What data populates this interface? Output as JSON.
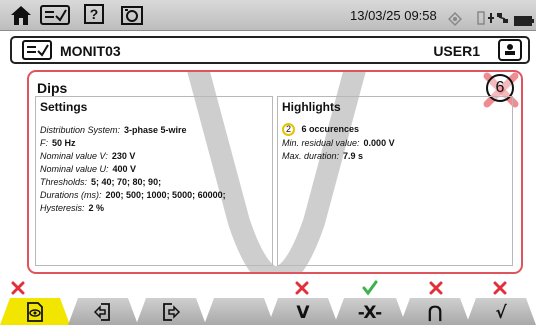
{
  "status_bar": {
    "datetime": "13/03/25 09:58",
    "help_label": "?",
    "network_label": "☉♁♂"
  },
  "header": {
    "title": "MONIT03",
    "user": "USER1"
  },
  "panel": {
    "title": "Dips",
    "count": "6",
    "settings": {
      "title": "Settings",
      "rows": [
        {
          "label": "Distribution System:",
          "value": "3-phase 5-wire"
        },
        {
          "label": "F:",
          "value": "50 Hz"
        },
        {
          "label": "Nominal value V:",
          "value": "230 V"
        },
        {
          "label": "Nominal value U:",
          "value": "400 V"
        },
        {
          "label": "Thresholds:",
          "value": "5; 40; 70; 80; 90;"
        },
        {
          "label": "Durations (ms):",
          "value": "200; 500; 1000; 5000; 60000;"
        },
        {
          "label": "Hysteresis:",
          "value": "2 %"
        }
      ]
    },
    "highlights": {
      "title": "Highlights",
      "badge": "2",
      "occurrences": "6 occurences",
      "rows": [
        {
          "label": "Min. residual value:",
          "value": "0.000 V"
        },
        {
          "label": "Max. duration:",
          "value": "7.9 s"
        }
      ]
    }
  },
  "tabs": [
    {
      "name": "view",
      "label": "◉",
      "status": "none"
    },
    {
      "name": "import",
      "label": "⇦",
      "status": "none"
    },
    {
      "name": "export",
      "label": "⇨",
      "status": "none"
    },
    {
      "name": "empty",
      "label": "",
      "status": "none"
    },
    {
      "name": "dips",
      "label": "V",
      "status": "inactive"
    },
    {
      "name": "interruptions",
      "label": "-X-",
      "status": "active"
    },
    {
      "name": "swells",
      "label": "⋂",
      "status": "inactive"
    },
    {
      "name": "transients",
      "label": "√",
      "status": "inactive"
    }
  ],
  "colors": {
    "active_tab": "#f2e600",
    "red_x": "#e2303a",
    "green_check": "#3bb34a",
    "panel_border": "#e0555d"
  }
}
